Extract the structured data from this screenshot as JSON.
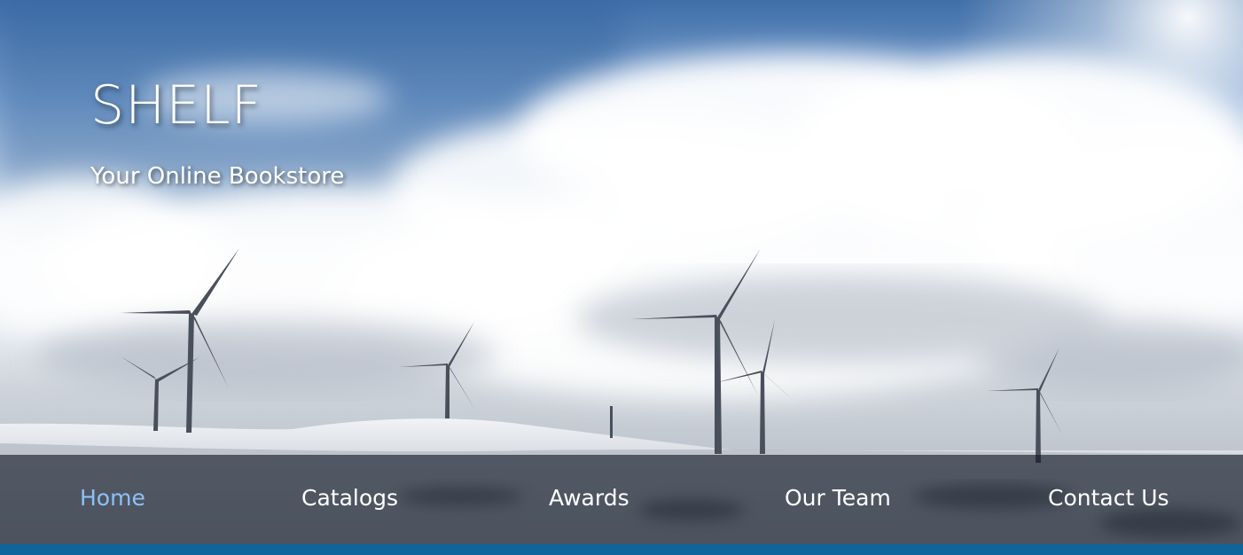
{
  "brand": {
    "title": "SHELF",
    "subtitle": "Your Online Bookstore"
  },
  "nav": {
    "items": [
      {
        "label": "Home",
        "active": true
      },
      {
        "label": "Catalogs",
        "active": false
      },
      {
        "label": "Awards",
        "active": false
      },
      {
        "label": "Our Team",
        "active": false
      },
      {
        "label": "Contact Us",
        "active": false
      }
    ]
  },
  "colors": {
    "nav_active": "#8fc0f4",
    "nav_text": "#ffffff",
    "accent_bar": "#0c659d"
  },
  "hero_image": "wind-turbines-on-snowy-hill-photo"
}
